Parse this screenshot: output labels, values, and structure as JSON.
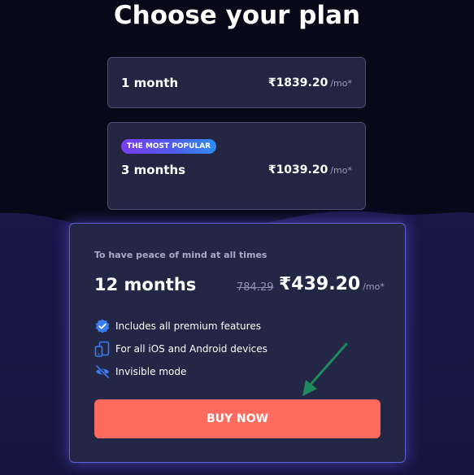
{
  "page": {
    "title": "Choose your plan"
  },
  "plans": [
    {
      "name": "1 month",
      "price": "₹1839.20",
      "per_month": "/mo*"
    },
    {
      "badge": "THE MOST POPULAR",
      "name": "3 months",
      "price": "₹1039.20",
      "per_month": "/mo*"
    }
  ],
  "featured": {
    "tagline": "To have peace of mind at all times",
    "name": "12 months",
    "old_price": "784.29",
    "price": "₹439.20",
    "per_month": "/mo*",
    "features": [
      {
        "icon": "verified-check-icon",
        "label": "Includes all premium features"
      },
      {
        "icon": "devices-icon",
        "label": "For all iOS and Android devices"
      },
      {
        "icon": "eye-off-icon",
        "label": "Invisible mode"
      }
    ],
    "button_label": "BUY NOW"
  },
  "colors": {
    "background": "#080818",
    "card": "#232543",
    "accent_blue": "#3b7cf0",
    "badge_gradient_start": "#7a3cf0",
    "badge_gradient_end": "#2d8cf0",
    "buy_button": "#ff6a5e",
    "annotation_arrow": "#1f8a5c"
  }
}
